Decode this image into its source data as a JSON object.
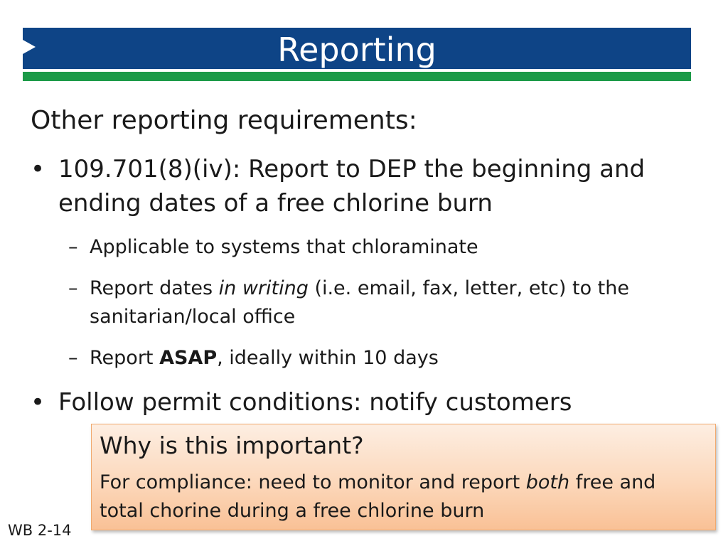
{
  "title": "Reporting",
  "colors": {
    "title_bar": "#0e4486",
    "accent_rule": "#1c9a48",
    "callout_fill_top": "#fdeee2",
    "callout_fill_bottom": "#f9c196",
    "callout_border": "#f0a96e"
  },
  "heading": "Other reporting requirements:",
  "bullets": [
    {
      "mark": "•",
      "line1": "109.701(8)(iv): Report to DEP the beginning and",
      "line2": "ending dates of a free chlorine burn",
      "subs": [
        {
          "mark": "–",
          "text": "Applicable to systems that chloraminate"
        },
        {
          "mark": "–",
          "pre": "Report dates ",
          "italic": "in writing",
          "post": " (i.e. email, fax, letter, etc) to the",
          "line2": "sanitarian/local office"
        },
        {
          "mark": "–",
          "pre": "Report ",
          "bold": "ASAP",
          "post": ", ideally within 10 days"
        }
      ]
    },
    {
      "mark": "•",
      "line1": "Follow permit conditions: notify customers"
    }
  ],
  "callout": {
    "title": "Why is this important?",
    "pre": "For compliance: need to monitor and report ",
    "italic": "both",
    "post": " free and",
    "line2": "total chorine during a free chlorine burn"
  },
  "footer": "WB 2-14"
}
